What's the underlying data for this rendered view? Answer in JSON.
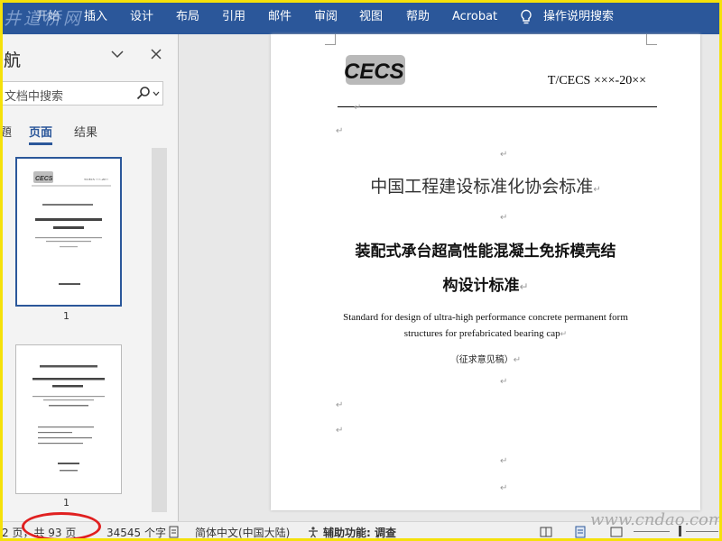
{
  "ribbon": {
    "watermark": "井道桥网",
    "tabs": [
      "开始",
      "插入",
      "设计",
      "布局",
      "引用",
      "邮件",
      "审阅",
      "视图",
      "帮助",
      "Acrobat"
    ],
    "tell_me": "操作说明搜索",
    "bg_color": "#2b579a"
  },
  "nav": {
    "title": "航",
    "search_placeholder": "文档中搜索",
    "tabs": [
      "題",
      "页面",
      "结果"
    ],
    "active_tab": "页面",
    "thumbnails": [
      {
        "page_label": "1",
        "logo": "CECS",
        "code": "T/CECS ×××-20××"
      },
      {
        "page_label": "1"
      }
    ]
  },
  "doc": {
    "logo_text": "CECS",
    "code": "T/CECS ×××-20××",
    "association": "中国工程建设标准化协会标准",
    "title_line1": "装配式承台超高性能混凝土免拆模壳结",
    "title_line2": "构设计标准",
    "title_en_line1": "Standard for design of ultra-high performance concrete permanent form",
    "title_en_line2": "structures for prefabricated bearing cap",
    "draft": "（征求意见稿）",
    "para_mark": "↵"
  },
  "status": {
    "page_info_partial": "2 页，共 93 页",
    "word_count": "34545 个字",
    "language": "简体中文(中国大陆)",
    "accessibility": "辅助功能: 调查"
  },
  "site_watermark": "www.cndao.com",
  "colors": {
    "accent": "#2b579a",
    "highlight_circle": "#e02020",
    "frame": "#f5e10a"
  }
}
